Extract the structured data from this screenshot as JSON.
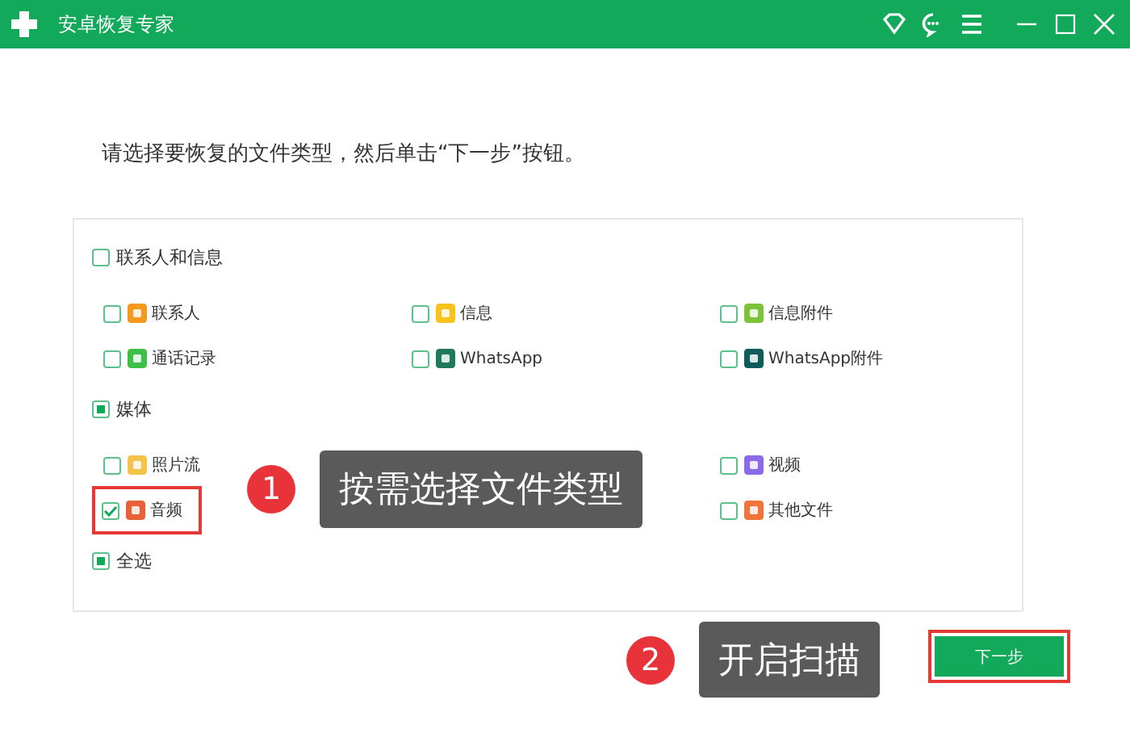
{
  "window": {
    "title": "安卓恢复专家"
  },
  "instruction": "请选择要恢复的文件类型，然后单击“下一步”按钮。",
  "groups": [
    {
      "label": "联系人和信息",
      "partial": false,
      "columns": [
        [
          {
            "label": "联系人",
            "checked": false,
            "highlighted": false,
            "color": "#f39a1e"
          },
          {
            "label": "通话记录",
            "checked": false,
            "highlighted": false,
            "color": "#3cc04a"
          }
        ],
        [
          {
            "label": "信息",
            "checked": false,
            "highlighted": false,
            "color": "#f7c21a"
          },
          {
            "label": "WhatsApp",
            "checked": false,
            "highlighted": false,
            "color": "#1e7a5a"
          }
        ],
        [
          {
            "label": "信息附件",
            "checked": false,
            "highlighted": false,
            "color": "#7cc23a"
          },
          {
            "label": "WhatsApp附件",
            "checked": false,
            "highlighted": false,
            "color": "#0f5a5a"
          }
        ]
      ]
    },
    {
      "label": "媒体",
      "partial": true,
      "columns": [
        [
          {
            "label": "照片流",
            "checked": false,
            "highlighted": false,
            "color": "#f2c44a"
          },
          {
            "label": "音频",
            "checked": true,
            "highlighted": true,
            "color": "#e8603a"
          }
        ],
        [],
        [
          {
            "label": "视频",
            "checked": false,
            "highlighted": false,
            "color": "#8a6ae8"
          },
          {
            "label": "其他文件",
            "checked": false,
            "highlighted": false,
            "color": "#f0743a"
          }
        ]
      ]
    }
  ],
  "select_all": {
    "label": "全选",
    "partial": true
  },
  "next_button": {
    "label": "下一步",
    "highlighted": true
  },
  "callouts": [
    {
      "number": "1",
      "text": "按需选择文件类型"
    },
    {
      "number": "2",
      "text": "开启扫描"
    }
  ]
}
